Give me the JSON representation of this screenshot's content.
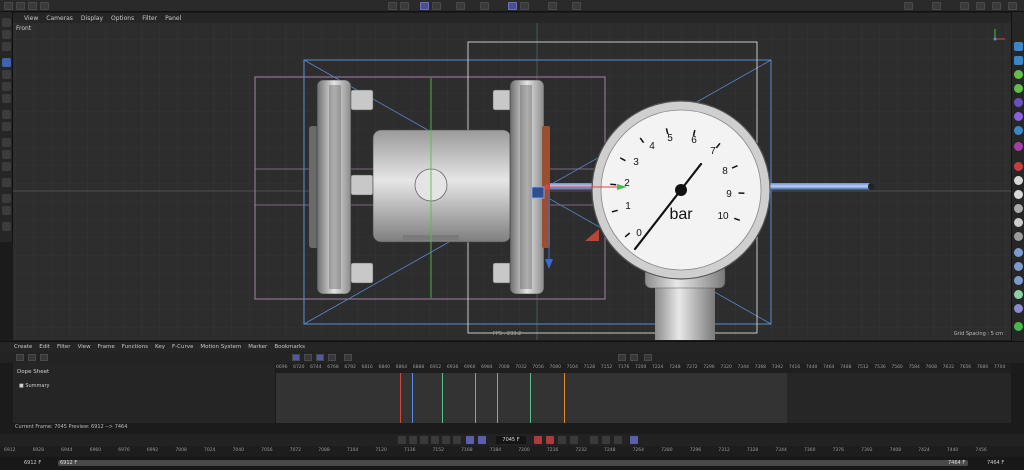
{
  "menu": {
    "items": [
      "View",
      "Cameras",
      "Display",
      "Options",
      "Filter",
      "Panel"
    ]
  },
  "viewport": {
    "label": "Front",
    "fps": "FPS : 233.2",
    "grid_spacing": "Grid Spacing : 5 cm",
    "gauge": {
      "unit": "bar",
      "dial_numbers": [
        "0",
        "1",
        "2",
        "3",
        "4",
        "5",
        "6",
        "7",
        "8",
        "9",
        "10"
      ]
    }
  },
  "timeline": {
    "menu": [
      "Create",
      "Edit",
      "Filter",
      "View",
      "Frame",
      "Functions",
      "Key",
      "F-Curve",
      "Motion System",
      "Marker",
      "Bookmarks"
    ],
    "dope_sheet_label": "Dope Sheet",
    "summary_label": "Summary",
    "ruler_ticks": [
      "6696",
      "6720",
      "6744",
      "6768",
      "6792",
      "6816",
      "6840",
      "6864",
      "6888",
      "6912",
      "6936",
      "6960",
      "6984",
      "7008",
      "7032",
      "7056",
      "7080",
      "7104",
      "7128",
      "7152",
      "7176",
      "7200",
      "7224",
      "7248",
      "7272",
      "7296",
      "7320",
      "7344",
      "7368",
      "7392",
      "7416",
      "7440",
      "7464",
      "7488",
      "7512",
      "7536",
      "7560",
      "7584",
      "7608",
      "7632",
      "7656",
      "7680",
      "7704"
    ],
    "current_frame_text": "Current Frame: 7045   Preview: 6912 --> 7464",
    "frame_field": "7045 F",
    "bottom_ticks": [
      "6912",
      "6928",
      "6944",
      "6960",
      "6976",
      "6992",
      "7008",
      "7024",
      "7040",
      "7056",
      "7072",
      "7088",
      "7104",
      "7120",
      "7136",
      "7152",
      "7168",
      "7184",
      "7200",
      "7216",
      "7232",
      "7248",
      "7264",
      "7280",
      "7296",
      "7312",
      "7328",
      "7344",
      "7360",
      "7376",
      "7392",
      "7408",
      "7424",
      "7440",
      "7456"
    ],
    "scrub_start": "6912 F",
    "scrub_range_start": "6912 F",
    "scrub_range_end": "7464 F",
    "scrub_end": "7464 F"
  },
  "colors": {
    "accent": "#5a5fb0",
    "key_red": "#d0493b",
    "key_green": "#58c08a",
    "key_orange": "#e08a2c",
    "key_blue": "#5a8fe0"
  }
}
